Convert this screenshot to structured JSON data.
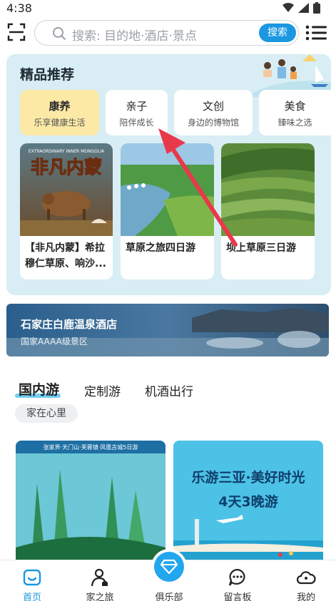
{
  "status_bar": {
    "time": "4:38"
  },
  "header": {
    "search_placeholder": "搜索: 目的地·酒店·景点",
    "search_button": "搜索"
  },
  "featured": {
    "title": "精品推荐",
    "categories": [
      {
        "title": "康养",
        "subtitle": "乐享健康生活",
        "active": true
      },
      {
        "title": "亲子",
        "subtitle": "陪伴成长",
        "active": false
      },
      {
        "title": "文创",
        "subtitle": "身边的博物馆",
        "active": false
      },
      {
        "title": "美食",
        "subtitle": "臻味之选",
        "active": false
      }
    ],
    "products": [
      {
        "title": "【非凡内蒙】希拉穆仁草原、响沙...",
        "image_text": "非凡内蒙",
        "image_caption": "EXTRAORDINARY INNER MONGOLIA"
      },
      {
        "title": "草原之旅四日游"
      },
      {
        "title": "坝上草原三日游"
      }
    ]
  },
  "hotel_banner": {
    "name": "石家庄白鹿温泉酒店",
    "subtitle": "国家AAAA级景区"
  },
  "tour_section": {
    "tabs": [
      {
        "label": "国内游",
        "active": true
      },
      {
        "label": "定制游",
        "active": false
      },
      {
        "label": "机酒出行",
        "active": false
      }
    ],
    "tag": "家在心里",
    "cards": [
      {
        "banner": "张家界·天门山·芙蓉镇·凤凰古城5日游"
      },
      {
        "headline": "乐游三亚·美好时光",
        "subheadline": "4天3晚游"
      }
    ]
  },
  "bottom_nav": {
    "items": [
      {
        "label": "首页",
        "icon": "home-icon",
        "active": true
      },
      {
        "label": "家之旅",
        "icon": "family-trip-icon",
        "active": false
      },
      {
        "label": "俱乐部",
        "icon": "diamond-icon",
        "active": false
      },
      {
        "label": "留言板",
        "icon": "message-icon",
        "active": false
      },
      {
        "label": "我的",
        "icon": "profile-cloud-icon",
        "active": false
      }
    ]
  },
  "colors": {
    "accent": "#1a97e0",
    "featured_bg": "#d8eef4",
    "active_category": "#fde9a6",
    "annotation_arrow": "#e8394a"
  }
}
